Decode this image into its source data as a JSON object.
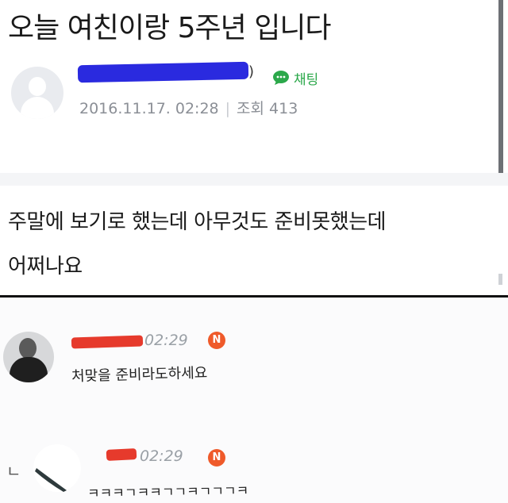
{
  "post": {
    "title": "오늘 여친이랑 5주년 입니다",
    "author_suffix": ")",
    "chat_label": "채팅",
    "date": "2016.11.17. 02:28",
    "views_label": "조회",
    "views": "413",
    "body_line1": "주말에 보기로 했는데 아무것도 준비못했는데",
    "body_line2": "어쩌나요"
  },
  "comments": [
    {
      "time": "02:29",
      "badge": "N",
      "text": "처맞을 준비라도하세요"
    },
    {
      "reply_marker": "ㄴ",
      "time": "02:29",
      "badge": "N",
      "text": "ㅋㅋㅋㄱㅋㅋㄱㄱㅋㄱㄱㄱㅋ"
    }
  ],
  "colors": {
    "chat_green": "#2ba84a",
    "badge_orange": "#ef5a2a",
    "redact_blue": "#2a2adf",
    "redact_red": "#e63a2c"
  },
  "icons": [
    "default-avatar-icon",
    "chat-bubble-icon",
    "new-badge-icon"
  ]
}
